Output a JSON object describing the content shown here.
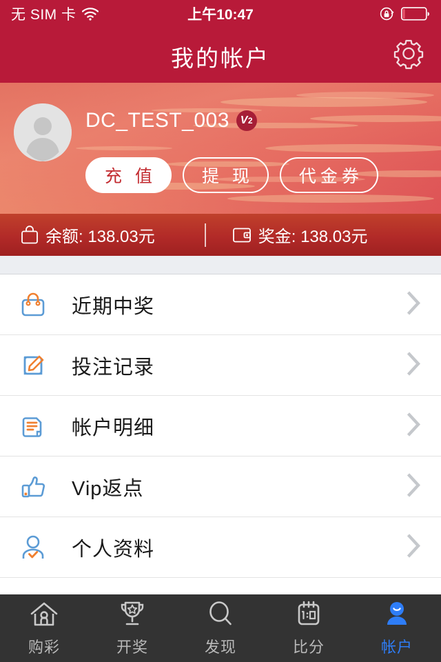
{
  "theme": {
    "header_red": "#b81a39",
    "balance_red": "#b22a28",
    "list_icon_blue": "#5b9bd5",
    "list_icon_orange": "#f08030",
    "tabbar_bg": "#333333",
    "tab_active": "#2e7df7",
    "chevron": "#c5c8cc"
  },
  "statusbar": {
    "carrier": "无 SIM 卡",
    "wifi_icon": "wifi-icon",
    "time": "上午10:47",
    "lock_icon": "rotation-lock-icon",
    "battery_icon": "battery-icon"
  },
  "header": {
    "title": "我的帐户",
    "settings_icon": "gear-icon"
  },
  "profile": {
    "avatar_icon": "avatar-placeholder-icon",
    "username": "DC_TEST_003",
    "badge": "V",
    "badge_sub": "2",
    "actions": [
      {
        "label": "充 值",
        "style": "filled",
        "name": "recharge-button"
      },
      {
        "label": "提 现",
        "style": "outline",
        "name": "withdraw-button"
      },
      {
        "label": "代金券",
        "style": "outline",
        "name": "voucher-button"
      }
    ]
  },
  "balance": {
    "wallet_icon": "bag-icon",
    "balance_text": "余额: 138.03元",
    "bonus_icon": "wallet-icon",
    "bonus_text": "奖金: 138.03元"
  },
  "menu": {
    "items": [
      {
        "label": "近期中奖",
        "icon": "shopping-bag-icon",
        "name": "menu-item-recent-wins"
      },
      {
        "label": "投注记录",
        "icon": "pencil-note-icon",
        "name": "menu-item-bet-records"
      },
      {
        "label": "帐户明细",
        "icon": "document-icon",
        "name": "menu-item-account-details"
      },
      {
        "label": "Vip返点",
        "icon": "thumbs-up-icon",
        "name": "menu-item-vip-rebate"
      },
      {
        "label": "个人资料",
        "icon": "user-check-icon",
        "name": "menu-item-personal-info"
      },
      {
        "label": "",
        "icon": "partial-icon",
        "name": "menu-item-partial"
      }
    ],
    "chevron_icon": "chevron-right-icon"
  },
  "tabbar": {
    "tabs": [
      {
        "label": "购彩",
        "icon": "home-icon",
        "active": false,
        "name": "tab-lottery"
      },
      {
        "label": "开奖",
        "icon": "trophy-icon",
        "active": false,
        "name": "tab-results"
      },
      {
        "label": "发现",
        "icon": "search-icon",
        "active": false,
        "name": "tab-discover"
      },
      {
        "label": "比分",
        "icon": "scoreboard-icon",
        "active": false,
        "name": "tab-scores"
      },
      {
        "label": "帐户",
        "icon": "person-icon",
        "active": true,
        "name": "tab-account"
      }
    ]
  }
}
